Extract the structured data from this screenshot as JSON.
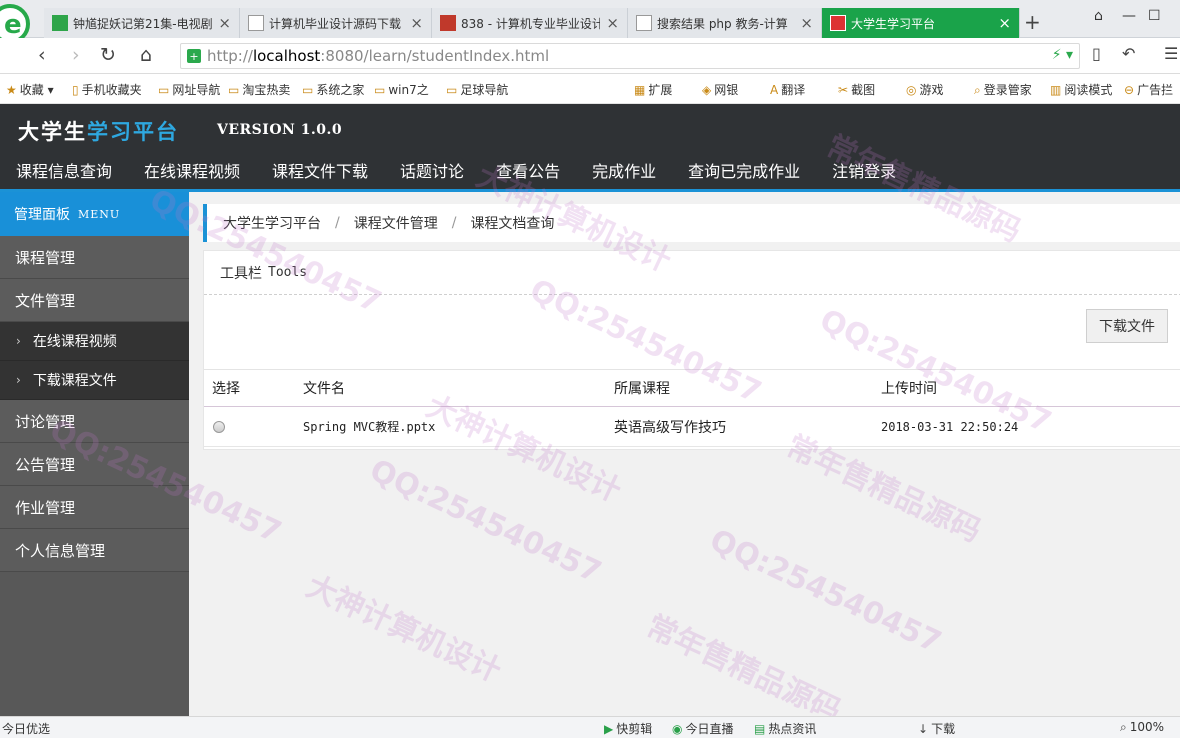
{
  "browser": {
    "tabs": [
      {
        "title": "钟馗捉妖记第21集-电视剧",
        "active": false
      },
      {
        "title": "计算机毕业设计源码下载",
        "active": false
      },
      {
        "title": "838 - 计算机专业毕业设计",
        "active": false
      },
      {
        "title": "搜索结果 php 教务-计算",
        "active": false
      },
      {
        "title": "大学生学习平台",
        "active": true
      }
    ],
    "url_scheme": "http://",
    "url_host": "localhost",
    "url_rest": ":8080/learn/studentIndex.html",
    "bookmarks_left": [
      "收藏",
      "手机收藏夹",
      "网址导航",
      "淘宝热卖",
      "系统之家",
      "win7之",
      "足球导航"
    ],
    "bookmarks_right": [
      "扩展",
      "网银",
      "翻译",
      "截图",
      "游戏",
      "登录管家",
      "阅读模式",
      "广告拦"
    ],
    "status_left": "今日优选",
    "status_items": [
      "快剪辑",
      "今日直播",
      "热点资讯",
      "下载"
    ],
    "zoom": "100%"
  },
  "app": {
    "brand_a": "大学生",
    "brand_b": "学习平台",
    "version": "VERSION 1.0.0",
    "topnav": [
      "课程信息查询",
      "在线课程视频",
      "课程文件下载",
      "话题讨论",
      "查看公告",
      "完成作业",
      "查询已完成作业",
      "注销登录"
    ]
  },
  "sidebar": {
    "header": "管理面板",
    "header_en": "MENU",
    "items_before": [
      "课程管理",
      "文件管理"
    ],
    "sub_items": [
      "在线课程视频",
      "下载课程文件"
    ],
    "items_after": [
      "讨论管理",
      "公告管理",
      "作业管理",
      "个人信息管理"
    ]
  },
  "breadcrumb": [
    "大学生学习平台",
    "课程文件管理",
    "课程文档查询"
  ],
  "toolbar": {
    "title": "工具栏",
    "title_en": "Tools",
    "download_label": "下载文件"
  },
  "table": {
    "headers": [
      "选择",
      "文件名",
      "所属课程",
      "上传时间"
    ],
    "rows": [
      {
        "file": "Spring MVC教程.pptx",
        "course": "英语高级写作技巧",
        "time": "2018-03-31 22:50:24"
      }
    ]
  },
  "watermark": {
    "lines": [
      "QQ:254540457",
      "大神计算机设计",
      "常年售精品源码"
    ]
  },
  "colors": {
    "header_bg": "#2f3235",
    "accent": "#1990d8",
    "sidebar_bg": "#585858",
    "tab_active": "#1aa34a"
  }
}
